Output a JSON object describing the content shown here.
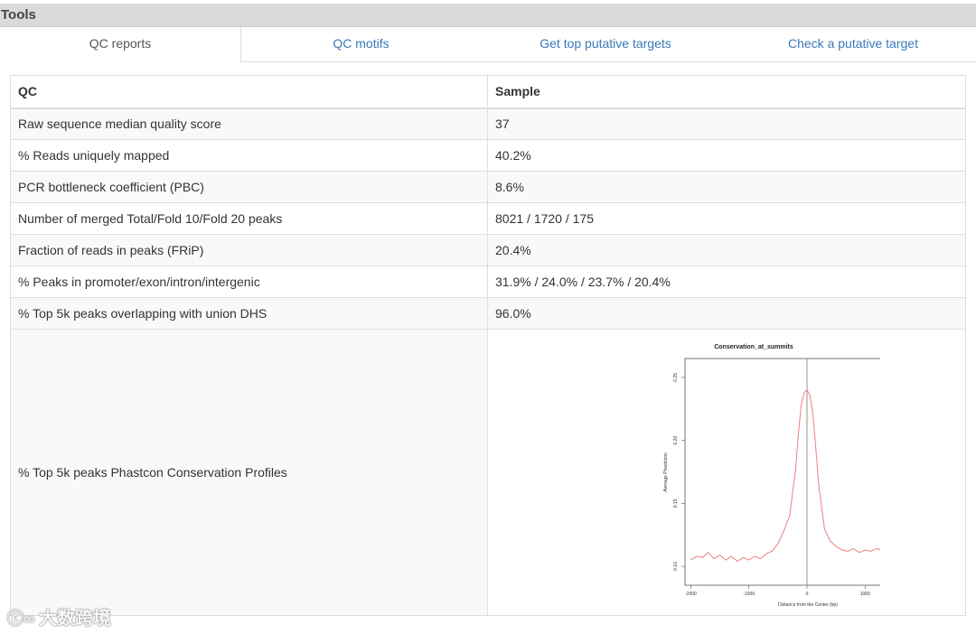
{
  "header": {
    "title": "Tools"
  },
  "tabs": [
    {
      "label": "QC reports",
      "active": true
    },
    {
      "label": "QC motifs",
      "active": false
    },
    {
      "label": "Get top putative targets",
      "active": false
    },
    {
      "label": "Check a putative target",
      "active": false
    }
  ],
  "table": {
    "headers": {
      "qc": "QC",
      "sample": "Sample"
    },
    "rows": [
      {
        "label": "Raw sequence median quality score",
        "value": "37"
      },
      {
        "label": "% Reads uniquely mapped",
        "value": "40.2%"
      },
      {
        "label": "PCR bottleneck coefficient (PBC)",
        "value": "8.6%"
      },
      {
        "label": "Number of merged Total/Fold 10/Fold 20 peaks",
        "value": "8021 / 1720 / 175"
      },
      {
        "label": "Fraction of reads in peaks (FRiP)",
        "value": "20.4%"
      },
      {
        "label": "% Peaks in promoter/exon/intron/intergenic",
        "value": "31.9% / 24.0% / 23.7% / 20.4%"
      },
      {
        "label": "% Top 5k peaks overlapping with union DHS",
        "value": "96.0%"
      },
      {
        "label": "% Top 5k peaks Phastcon Conservation Profiles",
        "value": ""
      }
    ]
  },
  "chart_data": {
    "type": "line",
    "title": "Conservation_at_summits",
    "xlabel": "Distance from the Center (bp)",
    "ylabel": "Average Phastcons",
    "xlim": [
      -2100,
      2100
    ],
    "ylim": [
      0.085,
      0.265
    ],
    "xticks": [
      -2000,
      -1000,
      0,
      1000,
      2000
    ],
    "yticks": [
      0.1,
      0.15,
      0.2,
      0.25
    ],
    "ytick_labels": [
      "0.10",
      "0.15",
      "0.20",
      "0.25"
    ],
    "vline_x": 0,
    "line_color": "#f08080",
    "x": [
      -2000,
      -1900,
      -1800,
      -1700,
      -1600,
      -1500,
      -1400,
      -1300,
      -1200,
      -1100,
      -1000,
      -900,
      -800,
      -700,
      -600,
      -500,
      -400,
      -300,
      -200,
      -150,
      -100,
      -50,
      0,
      50,
      100,
      150,
      200,
      300,
      400,
      500,
      600,
      700,
      800,
      900,
      1000,
      1100,
      1200,
      1300,
      1400,
      1500,
      1600,
      1700,
      1800,
      1900
    ],
    "y": [
      0.105,
      0.108,
      0.107,
      0.111,
      0.106,
      0.109,
      0.105,
      0.108,
      0.104,
      0.107,
      0.105,
      0.108,
      0.106,
      0.11,
      0.112,
      0.118,
      0.128,
      0.14,
      0.175,
      0.205,
      0.228,
      0.238,
      0.24,
      0.236,
      0.222,
      0.195,
      0.165,
      0.13,
      0.12,
      0.116,
      0.113,
      0.112,
      0.114,
      0.111,
      0.113,
      0.112,
      0.114,
      0.113,
      0.115,
      0.114,
      0.113,
      0.116,
      0.108,
      0.112
    ]
  },
  "watermark": {
    "text": "大数跨境"
  }
}
